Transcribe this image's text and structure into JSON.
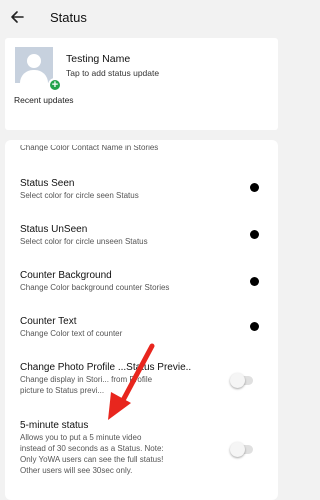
{
  "appbar": {
    "title": "Status",
    "back_icon": "arrow-left"
  },
  "my_status": {
    "name": "Testing Name",
    "subtitle": "Tap to add status update",
    "badge_icon": "plus",
    "badge_color": "#22a34a"
  },
  "recent_updates_label": "Recent updates",
  "settings": {
    "cut_item_subtitle": "Change Color Contact Name in Stories",
    "items": [
      {
        "title": "Status Seen",
        "subtitle": "Select color for circle seen Status",
        "control": "color-dot"
      },
      {
        "title": "Status UnSeen",
        "subtitle": "Select color for circle unseen Status",
        "control": "color-dot"
      },
      {
        "title": "Counter Background",
        "subtitle": "Change Color background counter Stories",
        "control": "color-dot"
      },
      {
        "title": "Counter Text",
        "subtitle": "Change Color text of counter",
        "control": "color-dot"
      },
      {
        "title": "Change Photo Profile ...Status Previe..",
        "subtitle_lines": [
          "Change display in Stori... from Profile",
          "picture to Status previ..."
        ],
        "control": "toggle",
        "toggle_on": false
      },
      {
        "title": "5-minute status",
        "subtitle_lines": [
          "Allows you to put a 5 minute video",
          "instead of 30 seconds as a Status. Note:",
          "Only YoWA users can see the full status!",
          "Other users will see 30sec only."
        ],
        "control": "toggle",
        "toggle_on": false
      }
    ]
  },
  "annotation": {
    "type": "arrow",
    "color": "#e8261e"
  }
}
